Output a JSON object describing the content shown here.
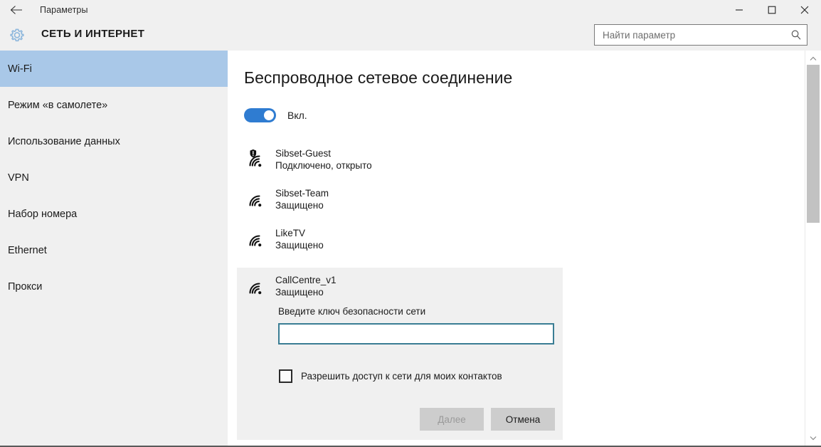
{
  "window": {
    "title": "Параметры",
    "back_icon": "back-arrow-icon",
    "minimize_label": "—",
    "maximize_label": "□",
    "close_label": "✕"
  },
  "header": {
    "gear_icon": "gear-icon",
    "page_title": "СЕТЬ И ИНТЕРНЕТ",
    "search": {
      "value": "",
      "placeholder": "Найти параметр",
      "icon": "search-icon"
    }
  },
  "sidebar": {
    "items": [
      {
        "label": "Wi-Fi",
        "selected": true
      },
      {
        "label": "Режим «в самолете»",
        "selected": false
      },
      {
        "label": "Использование данных",
        "selected": false
      },
      {
        "label": "VPN",
        "selected": false
      },
      {
        "label": "Набор номера",
        "selected": false
      },
      {
        "label": "Ethernet",
        "selected": false
      },
      {
        "label": "Прокси",
        "selected": false
      }
    ]
  },
  "main": {
    "heading": "Беспроводное сетевое соединение",
    "toggle": {
      "state": "on",
      "label": "Вкл."
    },
    "networks": [
      {
        "name": "Sibset-Guest",
        "status": "Подключено, открыто",
        "icon": "wifi-open-warning-icon",
        "secured": false
      },
      {
        "name": "Sibset-Team",
        "status": "Защищено",
        "icon": "wifi-icon",
        "secured": true
      },
      {
        "name": "LikeTV",
        "status": "Защищено",
        "icon": "wifi-icon",
        "secured": true
      }
    ],
    "expanded_network": {
      "name": "CallCentre_v1",
      "status": "Защищено",
      "icon": "wifi-icon",
      "prompt": "Введите ключ безопасности сети",
      "password": {
        "value": "",
        "placeholder": ""
      },
      "share_checkbox": {
        "label": "Разрешить доступ к сети для моих контактов",
        "checked": false
      },
      "next_button": {
        "label": "Далее",
        "disabled": true
      },
      "cancel_button": {
        "label": "Отмена",
        "disabled": false
      }
    }
  },
  "scrollbar": {
    "up_icon": "chevron-up-icon",
    "down_icon": "chevron-down-icon"
  },
  "colors": {
    "accent_blue": "#2f7cd1",
    "selection_blue": "#a9c8e8",
    "chrome_gray": "#f0f0f0",
    "panel_gray": "#f0f0f0",
    "button_gray": "#cdcdcd",
    "input_focus_border": "#3a7d94"
  }
}
